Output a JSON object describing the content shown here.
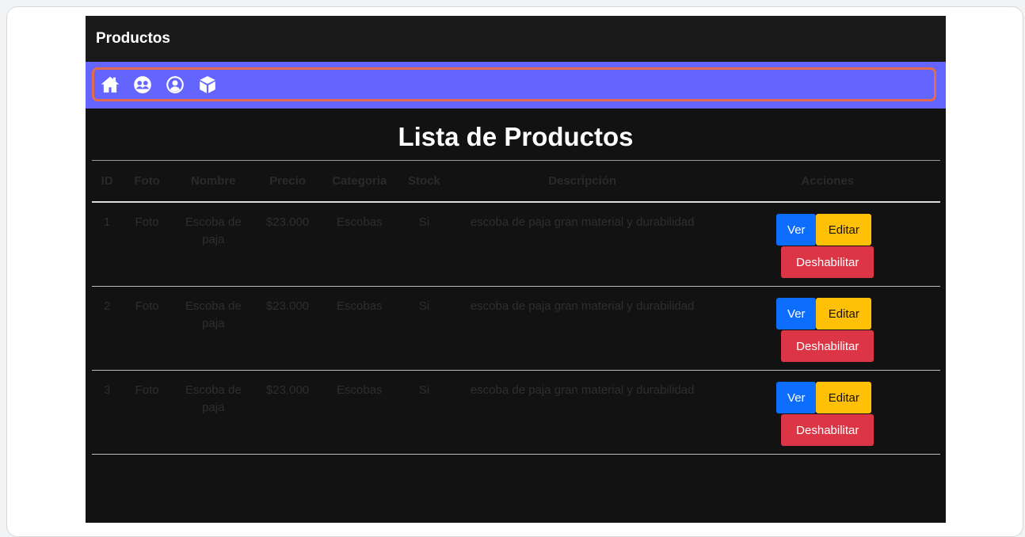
{
  "app": {
    "title": "Productos"
  },
  "nav": {
    "icons": [
      "home-icon",
      "users-icon",
      "user-circle-icon",
      "box-icon"
    ]
  },
  "page": {
    "title": "Lista de Productos"
  },
  "table": {
    "headers": [
      "ID",
      "Foto",
      "Nombre",
      "Precio",
      "Categoria",
      "Stock",
      "Descripción",
      "Acciones"
    ],
    "rows": [
      {
        "id": "1",
        "foto": "Foto",
        "nombre": "Escoba de paja",
        "precio": "$23.000",
        "categoria": "Escobas",
        "stock": "Si",
        "descripcion": "escoba de paja gran material y durabilidad"
      },
      {
        "id": "2",
        "foto": "Foto",
        "nombre": "Escoba de paja",
        "precio": "$23.000",
        "categoria": "Escobas",
        "stock": "Si",
        "descripcion": "escoba de paja gran material y durabilidad"
      },
      {
        "id": "3",
        "foto": "Foto",
        "nombre": "Escoba de paja",
        "precio": "$23.000",
        "categoria": "Escobas",
        "stock": "Si",
        "descripcion": "escoba de paja gran material y durabilidad"
      }
    ],
    "actions": {
      "view": "Ver",
      "edit": "Editar",
      "disable": "Deshabilitar"
    }
  },
  "colors": {
    "navbar": "#6464ff",
    "focus_ring": "#e56b4d",
    "view_button": "#0d6efd",
    "edit_button": "#ffc107",
    "disable_button": "#dc3545"
  }
}
